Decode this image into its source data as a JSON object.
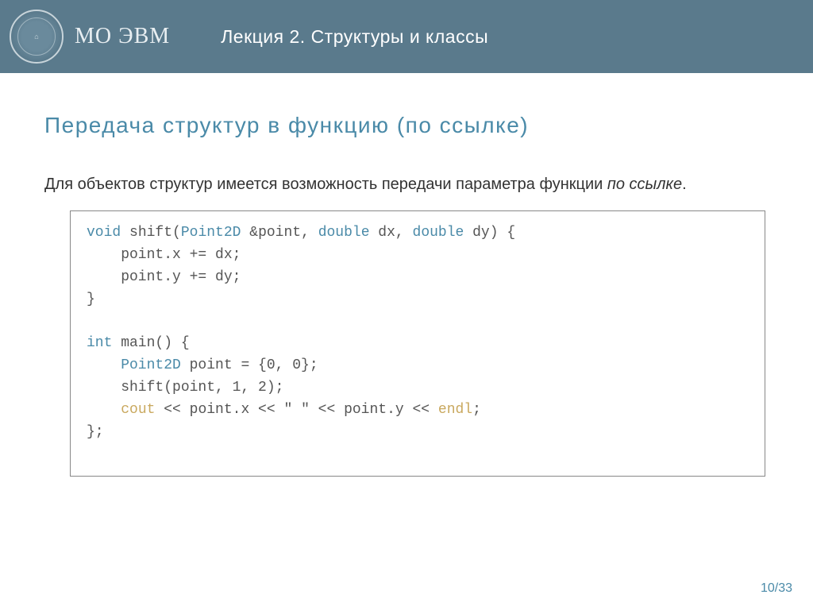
{
  "header": {
    "logo_text": "МО ЭВМ",
    "lecture_title": "Лекция 2.  Структуры и классы"
  },
  "content": {
    "section_title": "Передача структур в функцию (по ссылке)",
    "body_pre": "Для объектов структур имеется возможность передачи параметра функции ",
    "body_italic": "по ссылке",
    "body_post": "."
  },
  "code": {
    "l1_void": "void",
    "l1_fn": " shift(",
    "l1_type": "Point2D",
    "l1_after_type": " &point, ",
    "l1_double1": "double",
    "l1_dx": " dx, ",
    "l1_double2": "double",
    "l1_dy_end": " dy) {",
    "l2": "    point.x += dx;",
    "l3": "    point.y += dy;",
    "l4": "}",
    "l6_int": "int",
    "l6_main": " main() {",
    "l7_type": "    Point2D",
    "l7_rest": " point = {0, 0};",
    "l8": "    shift(point, 1, 2);",
    "l9_pre": "    ",
    "l9_cout": "cout",
    "l9_mid": " << point.x << \" \" << point.y << ",
    "l9_endl": "endl",
    "l9_semi": ";",
    "l10": "};"
  },
  "footer": {
    "page": "10/33"
  }
}
